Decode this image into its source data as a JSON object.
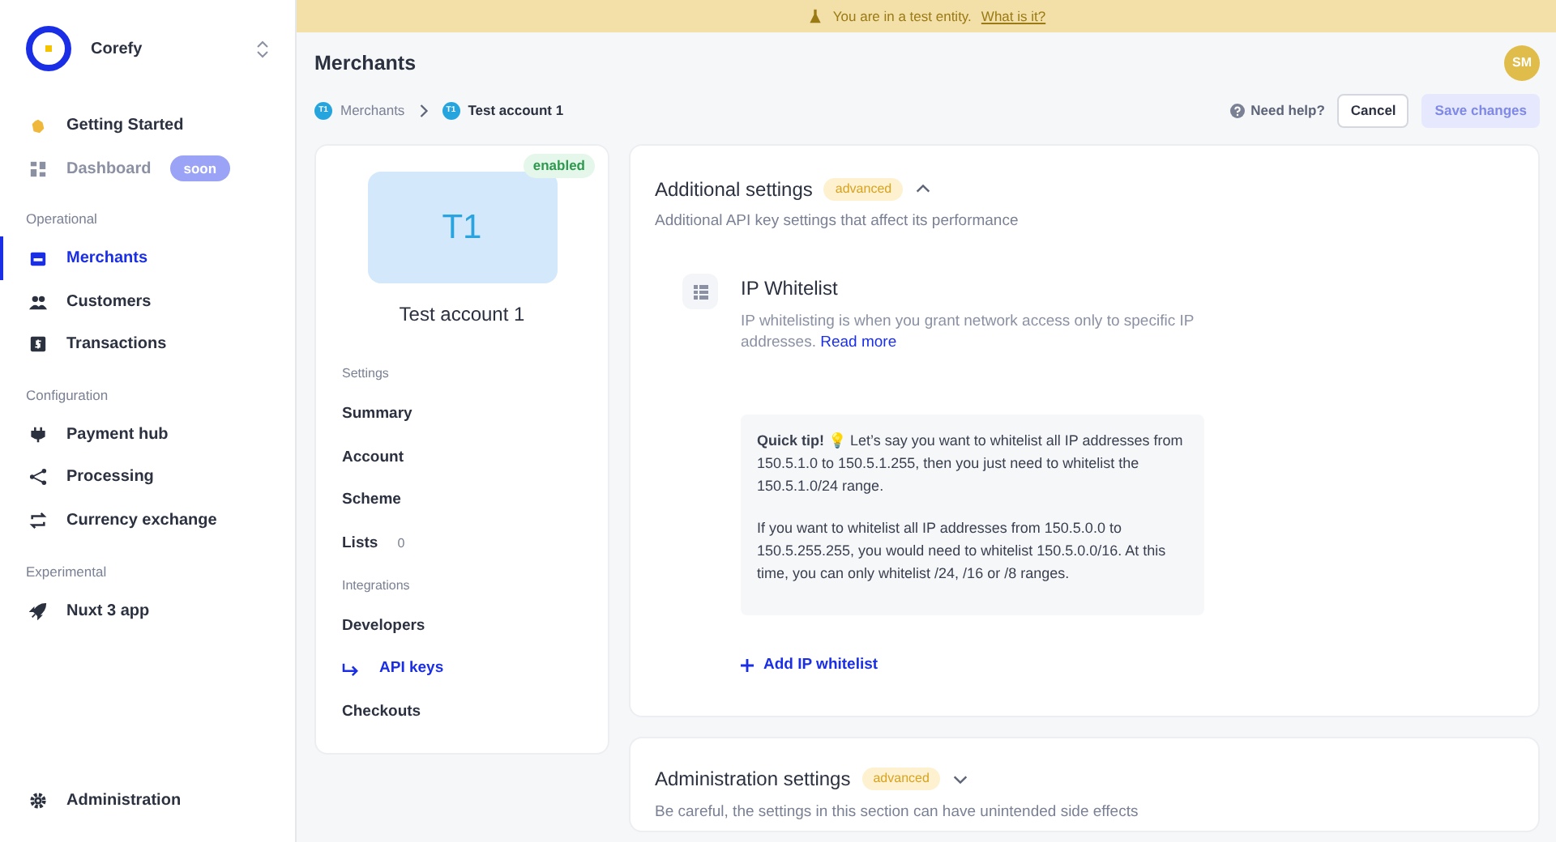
{
  "sidebar": {
    "brand": "Corefy",
    "items": [
      {
        "kind": "link",
        "label": "Getting Started",
        "selected": false,
        "disabled": false
      },
      {
        "kind": "link",
        "label": "Dashboard",
        "selected": false,
        "disabled": true,
        "badge": "soon"
      },
      {
        "kind": "section",
        "label": "Operational"
      },
      {
        "kind": "link",
        "label": "Merchants",
        "selected": true,
        "disabled": false
      },
      {
        "kind": "link",
        "label": "Customers",
        "selected": false,
        "disabled": false
      },
      {
        "kind": "link",
        "label": "Transactions",
        "selected": false,
        "disabled": false
      },
      {
        "kind": "section",
        "label": "Configuration"
      },
      {
        "kind": "link",
        "label": "Payment hub",
        "selected": false,
        "disabled": false
      },
      {
        "kind": "link",
        "label": "Processing",
        "selected": false,
        "disabled": false
      },
      {
        "kind": "link",
        "label": "Currency exchange",
        "selected": false,
        "disabled": false
      },
      {
        "kind": "section",
        "label": "Experimental"
      },
      {
        "kind": "link",
        "label": "Nuxt 3 app",
        "selected": false,
        "disabled": false
      }
    ],
    "footer": {
      "label": "Administration",
      "selected": false
    }
  },
  "banner": {
    "text": "You are in a test entity.",
    "link": "What is it?"
  },
  "page": {
    "title": "Merchants",
    "avatar": "SM",
    "breadcrumbs": [
      {
        "badge": "T1",
        "label": "Merchants",
        "current": false
      },
      {
        "badge": "T1",
        "label": "Test account 1",
        "current": true
      }
    ],
    "help": "Need help?",
    "buttons": [
      {
        "label": "Cancel",
        "disabled": false
      },
      {
        "label": "Save changes",
        "disabled": true
      }
    ]
  },
  "account": {
    "status": "enabled",
    "initials": "T1",
    "name": "Test account 1",
    "groups": [
      {
        "title": "Settings",
        "items": [
          {
            "label": "Summary",
            "selected": false
          },
          {
            "label": "Account",
            "selected": false
          },
          {
            "label": "Scheme",
            "selected": false
          },
          {
            "label": "Lists",
            "selected": false,
            "count": "0"
          }
        ]
      },
      {
        "title": "Integrations",
        "items": [
          {
            "label": "Developers",
            "selected": false
          },
          {
            "label": "API keys",
            "selected": true
          },
          {
            "label": "Checkouts",
            "selected": false
          }
        ]
      }
    ]
  },
  "sections": [
    {
      "title": "Additional settings",
      "tag": "advanced",
      "expanded": true,
      "description": "Additional API key settings that affect its performance",
      "feature": {
        "title": "IP Whitelist",
        "description": "IP whitelisting is when you grant network access only to specific IP addresses.",
        "link": "Read more",
        "tip": [
          "**Quick tip!** 💡 Let’s say you want to whitelist all IP addresses from 150.5.1.0 to 150.5.1.255, then you just need to whitelist the 150.5.1.0/24 range.",
          "If you want to whitelist all IP addresses from 150.5.0.0 to 150.5.255.255, you would need to whitelist 150.5.0.0/16. At this time, you can only whitelist /24, /16 or /8 ranges."
        ],
        "action": "Add IP whitelist"
      }
    },
    {
      "title": "Administration settings",
      "tag": "advanced",
      "expanded": false,
      "description": "Be careful, the settings in this section can have unintended side effects"
    }
  ]
}
